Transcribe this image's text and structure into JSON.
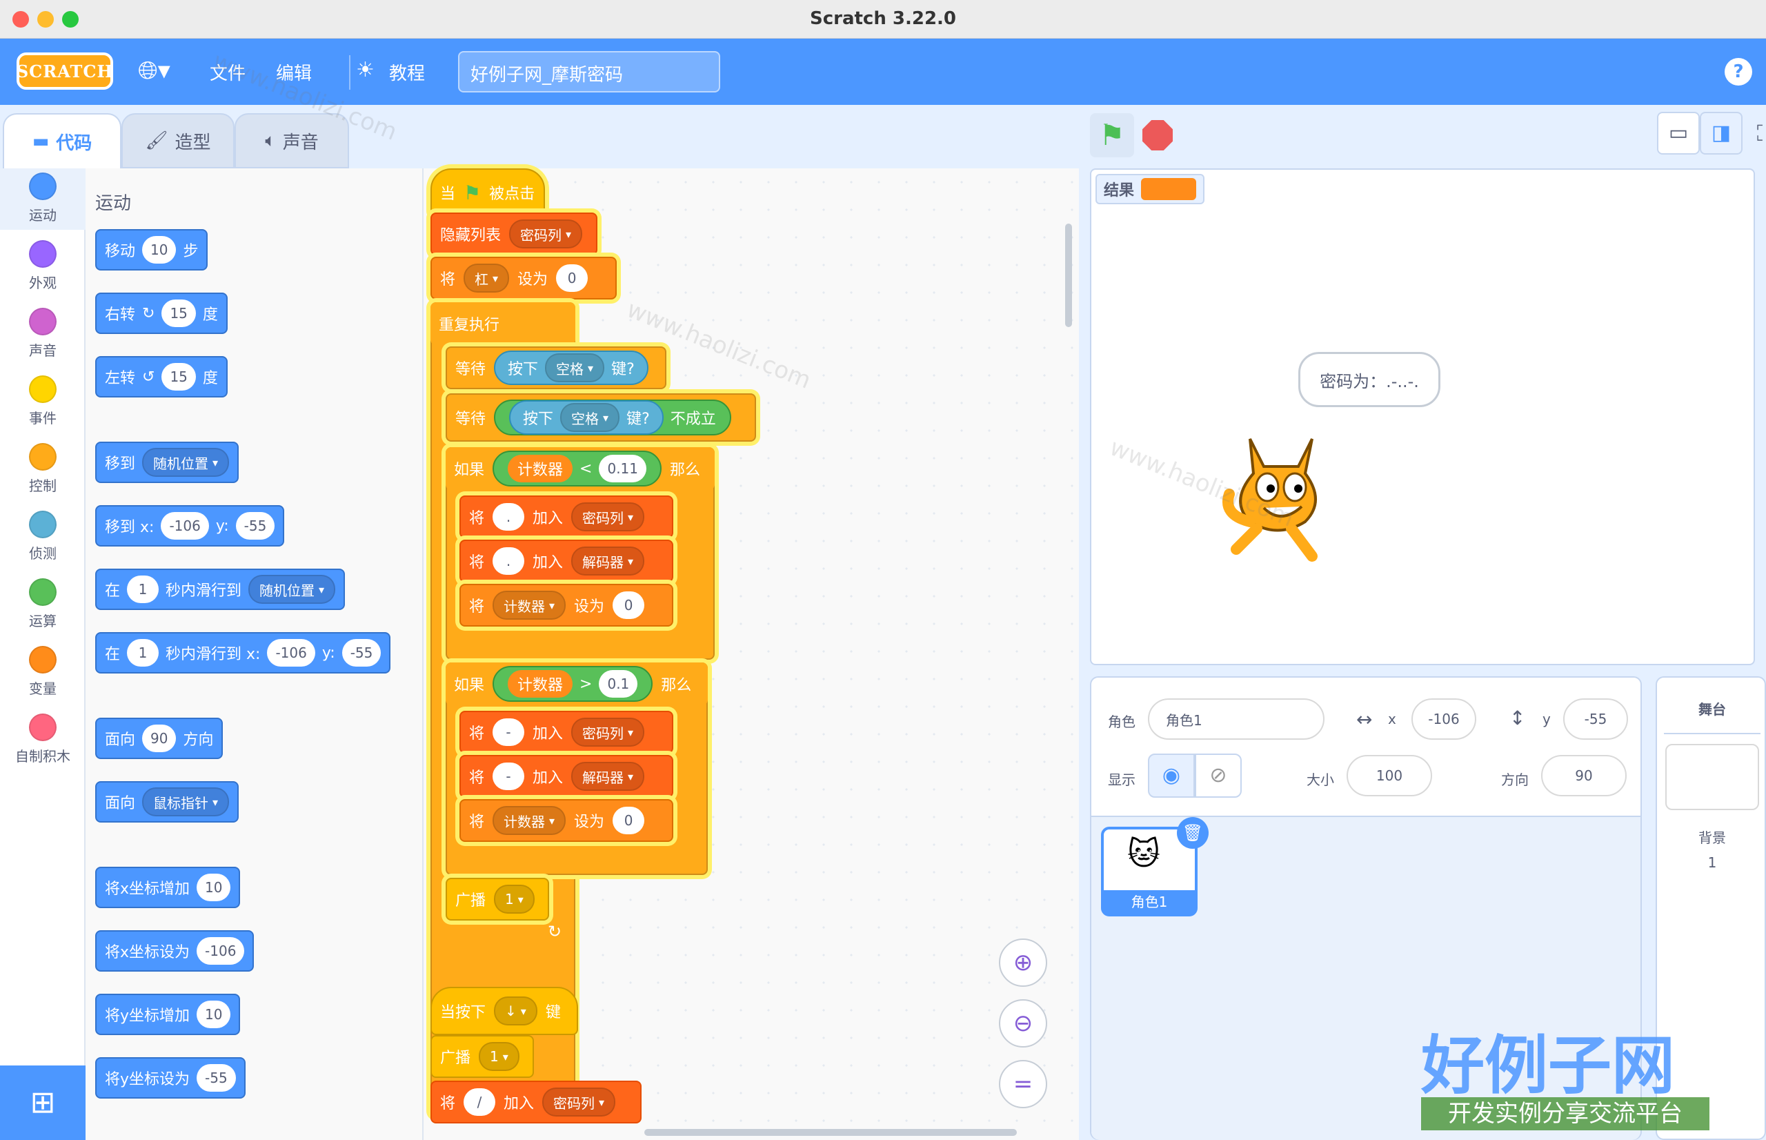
{
  "window": {
    "title": "Scratch 3.22.0"
  },
  "menubar": {
    "logo": "SCRATCH",
    "file": "文件",
    "edit": "编辑",
    "tutorials": "教程",
    "project_title": "好例子网_摩斯密码",
    "help": "?"
  },
  "tabs": {
    "code": "代码",
    "costumes": "造型",
    "sounds": "声音"
  },
  "categories": [
    {
      "label": "运动",
      "color": "#4c97ff"
    },
    {
      "label": "外观",
      "color": "#9966ff"
    },
    {
      "label": "声音",
      "color": "#cf63cf"
    },
    {
      "label": "事件",
      "color": "#ffd500"
    },
    {
      "label": "控制",
      "color": "#ffab19"
    },
    {
      "label": "侦测",
      "color": "#5cb1d6"
    },
    {
      "label": "运算",
      "color": "#59c059"
    },
    {
      "label": "变量",
      "color": "#ff8c1a"
    },
    {
      "label": "自制积木",
      "color": "#ff6680"
    }
  ],
  "palette": {
    "heading": "运动",
    "move": {
      "a": "移动",
      "v": "10",
      "b": "步"
    },
    "turn_right": {
      "a": "右转",
      "v": "15",
      "b": "度"
    },
    "turn_left": {
      "a": "左转",
      "v": "15",
      "b": "度"
    },
    "goto": {
      "a": "移到",
      "dd": "随机位置"
    },
    "goto_xy": {
      "a": "移到 x:",
      "x": "-106",
      "b": "y:",
      "y": "-55"
    },
    "glide": {
      "a": "在",
      "v": "1",
      "b": "秒内滑行到",
      "dd": "随机位置"
    },
    "glide_xy": {
      "a": "在",
      "v": "1",
      "b": "秒内滑行到 x:",
      "x": "-106",
      "c": "y:",
      "y": "-55"
    },
    "point_dir": {
      "a": "面向",
      "v": "90",
      "b": "方向"
    },
    "point_towards": {
      "a": "面向",
      "dd": "鼠标指针"
    },
    "change_x": {
      "a": "将x坐标增加",
      "v": "10"
    },
    "set_x": {
      "a": "将x坐标设为",
      "v": "-106"
    },
    "change_y": {
      "a": "将y坐标增加",
      "v": "10"
    },
    "set_y": {
      "a": "将y坐标设为",
      "v": "-55"
    }
  },
  "script": {
    "hat": {
      "a": "当",
      "b": "被点击"
    },
    "hide_list": {
      "a": "隐藏列表",
      "dd": "密码列"
    },
    "set_var": {
      "a": "将",
      "dd": "杠",
      "b": "设为",
      "v": "0"
    },
    "forever": "重复执行",
    "wait1": {
      "a": "等待",
      "s1": "按下",
      "dd": "空格",
      "s2": "键?"
    },
    "wait2": {
      "a": "等待",
      "s1": "按下",
      "dd": "空格",
      "s2": "键?",
      "s3": "不成立"
    },
    "if1": {
      "a": "如果",
      "var": "计数器",
      "op": "<",
      "v": "0.11",
      "b": "那么"
    },
    "if1_add1": {
      "a": "将",
      "v": ".",
      "b": "加入",
      "dd": "密码列"
    },
    "if1_add2": {
      "a": "将",
      "v": ".",
      "b": "加入",
      "dd": "解码器"
    },
    "if1_set": {
      "a": "将",
      "dd": "计数器",
      "b": "设为",
      "v": "0"
    },
    "if2": {
      "a": "如果",
      "var": "计数器",
      "op": ">",
      "v": "0.1",
      "b": "那么"
    },
    "if2_add1": {
      "a": "将",
      "v": "-",
      "b": "加入",
      "dd": "密码列"
    },
    "if2_add2": {
      "a": "将",
      "v": "-",
      "b": "加入",
      "dd": "解码器"
    },
    "if2_set": {
      "a": "将",
      "dd": "计数器",
      "b": "设为",
      "v": "0"
    },
    "broadcast": {
      "a": "广播",
      "dd": "1"
    },
    "hat2": {
      "a": "当按下",
      "dd": "↓",
      "b": "键"
    },
    "broadcast2": {
      "a": "广播",
      "dd": "1"
    },
    "add3": {
      "a": "将",
      "v": "/",
      "b": "加入",
      "dd": "密码列"
    }
  },
  "stage": {
    "monitor_label": "结果",
    "speech": "密码为：.-..-."
  },
  "sprite_info": {
    "sprite_label": "角色",
    "sprite_name": "角色1",
    "x_label": "x",
    "x": "-106",
    "y_label": "y",
    "y": "-55",
    "show_label": "显示",
    "size_label": "大小",
    "size": "100",
    "dir_label": "方向",
    "direction": "90",
    "thumb_name": "角色1"
  },
  "stage_panel": {
    "title": "舞台",
    "backdrop_label": "背景",
    "backdrop_count": "1"
  },
  "watermark": {
    "site": "www.haolizi.com",
    "brand": "好例子网",
    "slogan": "开发实例分享交流平台"
  }
}
